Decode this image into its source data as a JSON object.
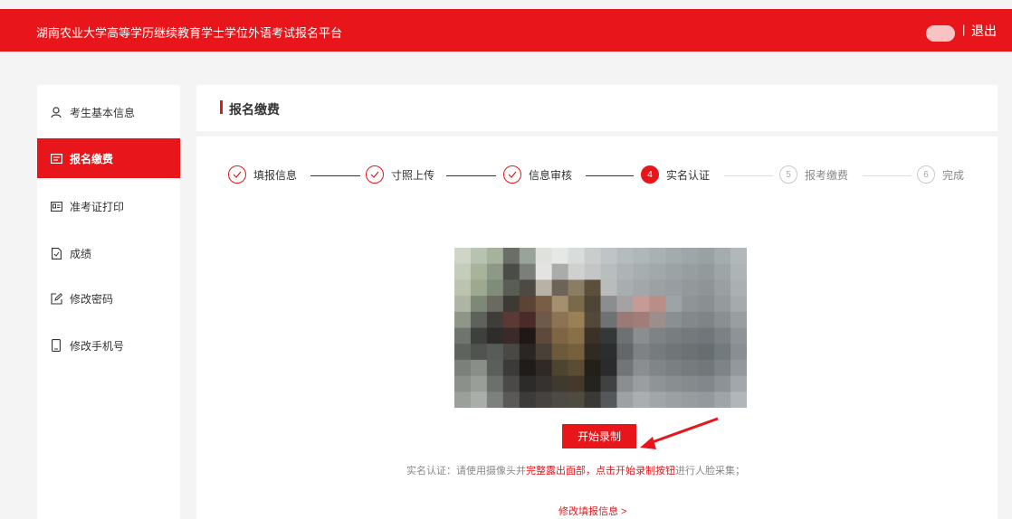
{
  "header": {
    "title": "湖南农业大学高等学历继续教育学士学位外语考试报名平台",
    "separator": "|",
    "logout_label": "退出"
  },
  "sidebar": {
    "items": [
      {
        "label": "考生基本信息",
        "icon": "user-icon",
        "active": false
      },
      {
        "label": "报名缴费",
        "icon": "payment-icon",
        "active": true
      },
      {
        "label": "准考证打印",
        "icon": "id-card-icon",
        "active": false
      },
      {
        "label": "成绩",
        "icon": "document-icon",
        "active": false
      },
      {
        "label": "修改密码",
        "icon": "edit-icon",
        "active": false
      },
      {
        "label": "修改手机号",
        "icon": "phone-icon",
        "active": false
      }
    ]
  },
  "main": {
    "title": "报名缴费",
    "steps": [
      {
        "label": "填报信息",
        "status": "done",
        "number": ""
      },
      {
        "label": "寸照上传",
        "status": "done",
        "number": ""
      },
      {
        "label": "信息审核",
        "status": "done",
        "number": ""
      },
      {
        "label": "实名认证",
        "status": "current",
        "number": "4"
      },
      {
        "label": "报考缴费",
        "status": "todo",
        "number": "5"
      },
      {
        "label": "完成",
        "status": "todo",
        "number": "6"
      }
    ],
    "record_button": "开始录制",
    "hint": {
      "prefix": "实名认证：请使用摄像头并",
      "highlight1": "完整露出面部，点击开始录制按钮",
      "suffix": "进行人脸采集；"
    },
    "modify_link": "修改填报信息 >"
  },
  "colors": {
    "brand": "#e8161b",
    "background": "#f4f4f4"
  }
}
